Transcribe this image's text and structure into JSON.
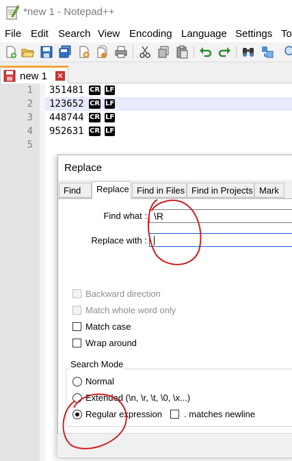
{
  "window": {
    "title": "*new 1 - Notepad++"
  },
  "menu": [
    "File",
    "Edit",
    "Search",
    "View",
    "Encoding",
    "Language",
    "Settings",
    "To"
  ],
  "tab": {
    "label": "new 1",
    "close_glyph": "✕"
  },
  "editor": {
    "lines": [
      {
        "no": "1",
        "text": "351481",
        "eol": [
          "CR",
          "LF"
        ]
      },
      {
        "no": "2",
        "text": "123652",
        "eol": [
          "CR",
          "LF"
        ]
      },
      {
        "no": "3",
        "text": "448744",
        "eol": [
          "CR",
          "LF"
        ]
      },
      {
        "no": "4",
        "text": "952631",
        "eol": [
          "CR",
          "LF"
        ]
      },
      {
        "no": "5",
        "text": "",
        "eol": []
      }
    ],
    "current_line": 2
  },
  "dialog": {
    "title": "Replace",
    "tabs": [
      "Find",
      "Replace",
      "Find in Files",
      "Find in Projects",
      "Mark"
    ],
    "active_tab": "Replace",
    "find_label": "Find what :",
    "find_value": "\\R",
    "replace_label": "Replace with :",
    "replace_value": "",
    "options": {
      "backward": "Backward direction",
      "whole_word": "Match whole word only",
      "match_case": "Match case",
      "wrap_around": "Wrap around"
    },
    "search_mode": {
      "title": "Search Mode",
      "normal": "Normal",
      "extended": "Extended (\\n, \\r, \\t, \\0, \\x...)",
      "regex": "Regular expression",
      "matches_newline": ". matches newline",
      "selected": "regex"
    }
  },
  "colors": {
    "annotation": "#cc1f1f",
    "tab_accent": "#f2a23a",
    "current_line": "#e8e8ff",
    "gutter": "#e4e4e4"
  }
}
